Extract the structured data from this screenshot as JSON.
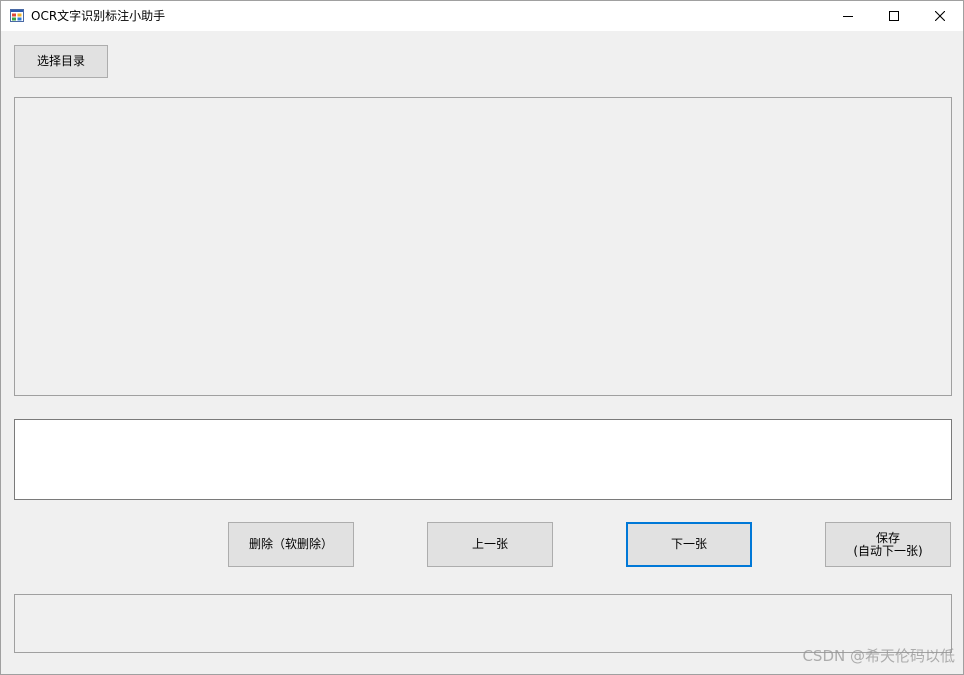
{
  "window": {
    "title": "OCR文字识别标注小助手",
    "icons": {
      "app": "app-window-icon",
      "minimize": "minimize-icon",
      "maximize": "maximize-icon",
      "close": "close-icon"
    }
  },
  "toolbar": {
    "select_dir_label": "选择目录"
  },
  "editor": {
    "text_value": "",
    "placeholder": ""
  },
  "actions": {
    "delete_label": "删除（软删除）",
    "prev_label": "上一张",
    "next_label": "下一张",
    "save_label": "保存\n(自动下一张)"
  },
  "watermark": {
    "text": "CSDN @希天伦码以低"
  },
  "colors": {
    "focus_border": "#0078d7",
    "button_bg": "#e1e1e1",
    "window_bg": "#f0f0f0",
    "titlebar_bg": "#ffffff"
  }
}
